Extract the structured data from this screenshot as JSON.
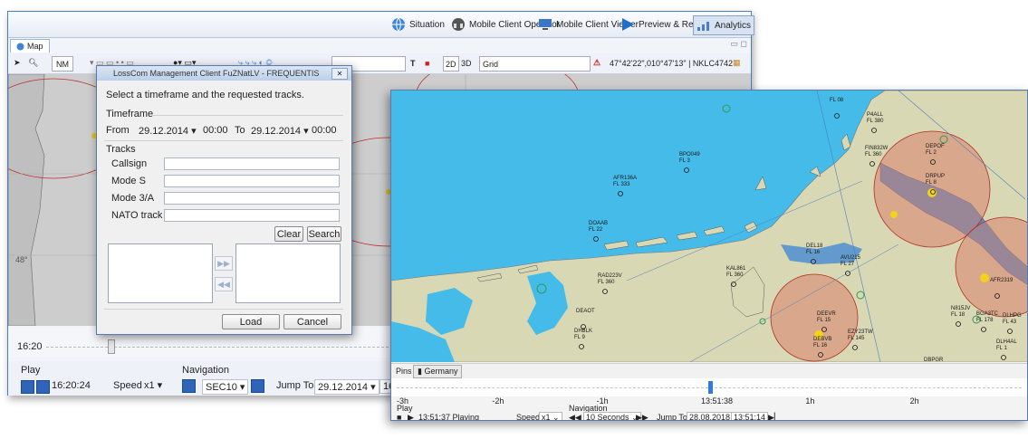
{
  "ribbon": {
    "buttons": [
      {
        "label": "Situation",
        "icon": "globe-icon"
      },
      {
        "label": "Mobile Client Operator",
        "icon": "headset-icon"
      },
      {
        "label": "Mobile Client Viewer",
        "icon": "monitor-icon"
      },
      {
        "label": "Preview & Replay",
        "icon": "play-icon"
      },
      {
        "label": "Analytics",
        "icon": "analytics-icon",
        "active": true
      }
    ]
  },
  "back_map": {
    "tab_label": "Map",
    "unit": "NM",
    "mode_2d": "2D",
    "mode_3d": "3D",
    "grid_select": "Grid",
    "coordinates": "47°42'22\",010°47'13\" | NKLC4742",
    "text_tool": "T",
    "lat_label": "48°"
  },
  "back_timeline": {
    "time_label": "16:20"
  },
  "back_controls": {
    "play_label": "Play",
    "play_time": "16:20:24",
    "speed_label": "Speed",
    "speed_value": "x1",
    "navigation_label": "Navigation",
    "nav_value": "SEC10",
    "jump_label": "Jump To",
    "jump_date": "29.12.2014",
    "jump_time_partial": "16:"
  },
  "dialog": {
    "title": "LossCom Management Client FuZNatLV - FREQUENTIS",
    "close": "✕",
    "instruction": "Select a timeframe and the requested tracks.",
    "timeframe_label": "Timeframe",
    "from_label": "From",
    "from_date": "29.12.2014",
    "from_time": "00:00",
    "to_label": "To",
    "to_date": "29.12.2014",
    "to_time": "00:00",
    "tracks_label": "Tracks",
    "fields": [
      "Callsign",
      "Mode S",
      "Mode 3/A",
      "NATO track #"
    ],
    "clear": "Clear",
    "search": "Search",
    "load": "Load",
    "cancel": "Cancel"
  },
  "front_map": {
    "aircraft": [
      {
        "callsign": "BPO049",
        "level": "FL 3"
      },
      {
        "callsign": "AFR136A",
        "level": "FL 333"
      },
      {
        "callsign": "DOAAB",
        "level": "FL 22"
      },
      {
        "callsign": "RAD223V",
        "level": "FL 360"
      },
      {
        "callsign": "KAL861",
        "level": "FL 360"
      },
      {
        "callsign": "DEAOT",
        "level": ""
      },
      {
        "callsign": "DHBLK",
        "level": "FL 9"
      },
      {
        "callsign": "DEBVB",
        "level": "FL 16"
      },
      {
        "callsign": "DEEVR",
        "level": "FL 15"
      },
      {
        "callsign": "EZY23TW",
        "level": "FL 145"
      },
      {
        "callsign": "DEL18",
        "level": "FL 16"
      },
      {
        "callsign": "AVU215",
        "level": "FL 27"
      },
      {
        "callsign": "FIN832W",
        "level": "FL 360"
      },
      {
        "callsign": "P4ALL",
        "level": "FL 380"
      },
      {
        "callsign": "DEPOF",
        "level": "FL 2"
      },
      {
        "callsign": "DRPUP",
        "level": "FL 8"
      },
      {
        "callsign": "N815JV",
        "level": "FL 18"
      },
      {
        "callsign": "BGA3TC",
        "level": "FL 178"
      },
      {
        "callsign": "DLHPG",
        "level": "FL 43"
      },
      {
        "callsign": "DLH4AL",
        "level": "FL 1"
      },
      {
        "callsign": "AFR2319",
        "level": ""
      },
      {
        "callsign": "DBPGR",
        "level": ""
      },
      {
        "callsign": "FL 08",
        "level": ""
      }
    ]
  },
  "front_pins": {
    "label": "Pins",
    "item": "Germany"
  },
  "front_timeline": {
    "labels": [
      "-3h",
      "-2h",
      "-1h",
      "13:51:38",
      "1h",
      "2h"
    ],
    "current": "13:51:38",
    "current_fraction": 0.5
  },
  "front_controls": {
    "play_label": "Play",
    "status": "13:51:37 Playing",
    "speed_label": "Speed",
    "speed_value": "x1",
    "navigation_label": "Navigation",
    "nav_value": "10 Seconds",
    "jump_label": "Jump To",
    "jump_date": "28.08.2018",
    "jump_time": "13:51:14"
  },
  "colors": {
    "sea": "#45bbea",
    "land": "#d9d8b5",
    "danger_zone": "#d9826a",
    "accent": "#2f65b8"
  }
}
